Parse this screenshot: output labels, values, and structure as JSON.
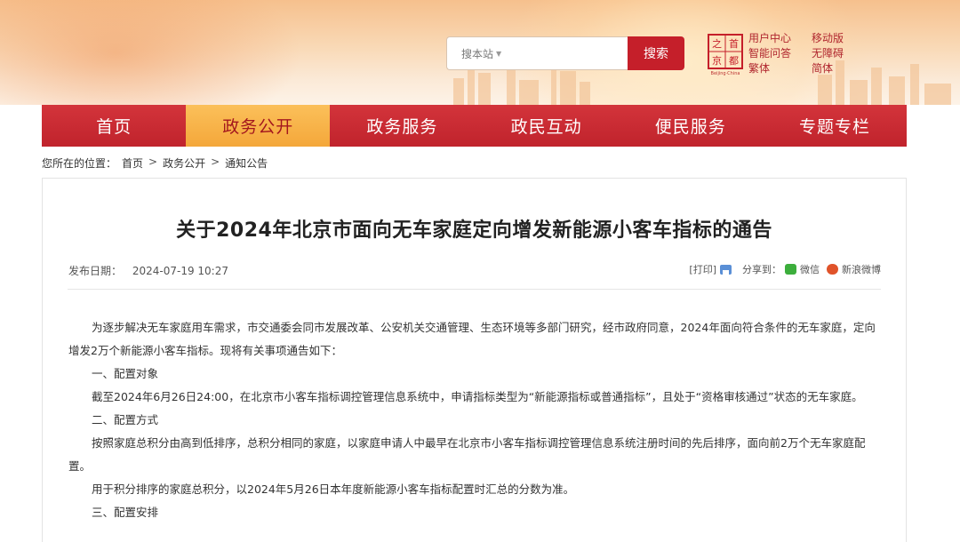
{
  "header": {
    "search": {
      "scope": "搜本站",
      "button": "搜索"
    },
    "seal": {
      "chars": [
        "之",
        "首",
        "京",
        "都"
      ],
      "caption": "Beijing·China"
    },
    "tools_left": [
      "用户中心",
      "智能问答",
      "繁体"
    ],
    "tools_right": [
      "移动版",
      "无障碍",
      "简体"
    ]
  },
  "nav": {
    "items": [
      "首页",
      "政务公开",
      "政务服务",
      "政民互动",
      "便民服务",
      "专题专栏"
    ],
    "active_index": 1
  },
  "breadcrumb": {
    "label": "您所在的位置：",
    "items": [
      "首页",
      "政务公开",
      "通知公告"
    ],
    "separator": ">"
  },
  "article": {
    "title": "关于2024年北京市面向无车家庭定向增发新能源小客车指标的通告",
    "date_label": "发布日期：",
    "date": "2024-07-19 10:27",
    "print": "[打印]",
    "share_label": "分享到：",
    "share_wechat": "微信",
    "share_weibo": "新浪微博",
    "paragraphs": [
      {
        "text": "为逐步解决无车家庭用车需求，市交通委会同市发展改革、公安机关交通管理、生态环境等多部门研究，经市政府同意，2024年面向符合条件的无车家庭，定向增发2万个新能源小客车指标。现将有关事项通告如下：",
        "indent": true
      },
      {
        "text": "一、配置对象",
        "indent": true
      },
      {
        "text": "截至2024年6月26日24:00，在北京市小客车指标调控管理信息系统中，申请指标类型为“新能源指标或普通指标”，且处于“资格审核通过”状态的无车家庭。",
        "indent": true
      },
      {
        "text": "二、配置方式",
        "indent": true
      },
      {
        "text": "按照家庭总积分由高到低排序，总积分相同的家庭，以家庭申请人中最早在北京市小客车指标调控管理信息系统注册时间的先后排序，面向前2万个无车家庭配置。",
        "indent": true
      },
      {
        "text": "用于积分排序的家庭总积分，以2024年5月26日本年度新能源小客车指标配置时汇总的分数为准。",
        "indent": true
      },
      {
        "text": "三、配置安排",
        "indent": true
      }
    ]
  },
  "colors": {
    "brand_red": "#c51f2a",
    "nav_active": "#f4a73a",
    "tool_link": "#b0262e"
  }
}
